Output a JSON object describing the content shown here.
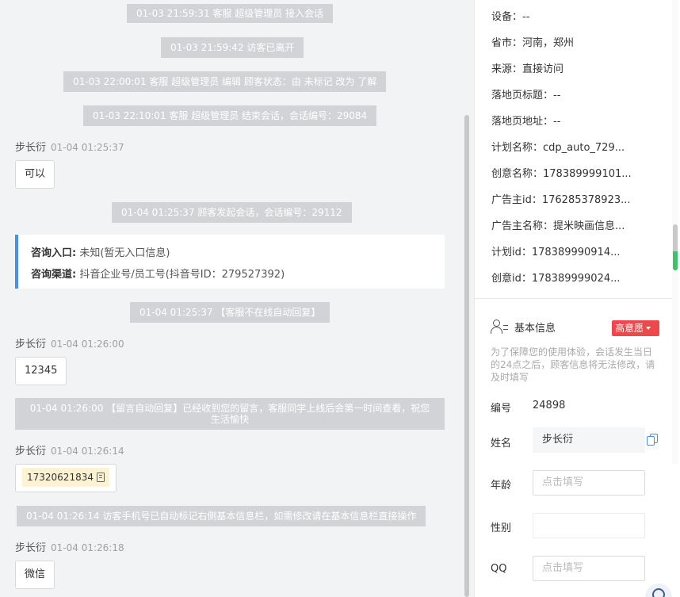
{
  "chat": {
    "system_messages": [
      "01-03 21:59:31 客服 超级管理员 接入会话",
      "01-03 21:59:42 访客已离开",
      "01-03 22:00:01 客服 超级管理员 编辑 顾客状态：由 未标记 改为 了解",
      "01-03 22:10:01 客服 超级管理员 结束会话，会话编号：29084",
      "01-04 01:25:37 顾客发起会话，会话编号：29112",
      "01-04 01:25:37 【客服不在线自动回复】",
      "01-04 01:26:00 【留言自动回复】已经收到您的留言，客服同学上线后会第一时间查看，祝您生活愉快",
      "01-04 01:26:14 访客手机号已自动标记右侧基本信息栏，如需修改请在基本信息栏直接操作"
    ],
    "visitor_name": "步长衍",
    "messages": [
      {
        "time": "01-04 01:25:37",
        "text": "可以"
      },
      {
        "time": "01-04 01:26:00",
        "text": "12345"
      },
      {
        "time": "01-04 01:26:14",
        "text": "17320621834"
      },
      {
        "time": "01-04 01:26:18",
        "text": "微信"
      }
    ],
    "entry_card": {
      "entry_label": "咨询入口:",
      "entry_value": "未知(暂无入口信息)",
      "channel_label": "咨询渠道:",
      "channel_value": "抖音企业号/员工号(抖音号ID：279527392)"
    }
  },
  "visitor_info": {
    "device": "设备：--",
    "region": "省市：河南，郑州",
    "source": "来源：直接访问",
    "landing_title": "落地页标题：--",
    "landing_url": "落地页地址：--",
    "plan_name": "计划名称：cdp_auto_729...",
    "creative_name": "创意名称：178389999101...",
    "advertiser_id": "广告主id：176285378923...",
    "advertiser_name": "广告主名称：提米映画信息...",
    "plan_id": "计划id：178389990914...",
    "creative_id": "创意id：178389999024..."
  },
  "basic_info": {
    "title": "基本信息",
    "intent_badge": "高意愿",
    "notice": "为了保障您的使用体验，会话发生当日的24点之后，顾客信息将无法修改，请及时填写",
    "id_label": "编号",
    "id_value": "24898",
    "name_label": "姓名",
    "name_value": "步长衍",
    "age_label": "年龄",
    "age_placeholder": "点击填写",
    "gender_label": "性别",
    "qq_label": "QQ",
    "qq_placeholder": "点击填写"
  }
}
